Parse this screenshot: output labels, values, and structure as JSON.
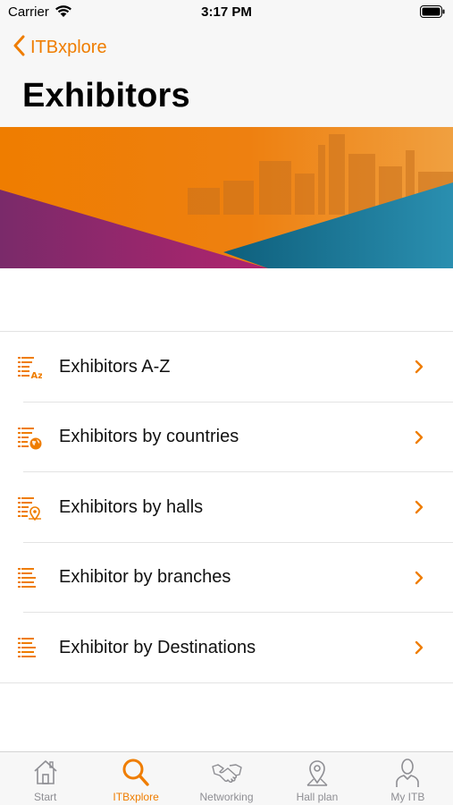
{
  "status_bar": {
    "carrier": "Carrier",
    "time": "3:17 PM"
  },
  "nav": {
    "back_label": "ITBxplore",
    "title": "Exhibitors"
  },
  "colors": {
    "accent": "#ef7d00",
    "banner_orange": "#ef7d00",
    "banner_purple": "#8e2a73",
    "banner_teal": "#1f7f9a"
  },
  "menu": {
    "items": [
      {
        "label": "Exhibitors A-Z",
        "icon": "list-az-icon"
      },
      {
        "label": "Exhibitors by countries",
        "icon": "list-globe-icon"
      },
      {
        "label": "Exhibitors by halls",
        "icon": "list-location-icon"
      },
      {
        "label": "Exhibitor by branches",
        "icon": "list-icon"
      },
      {
        "label": "Exhibitor by Destinations",
        "icon": "list-icon"
      }
    ]
  },
  "tabbar": {
    "tabs": [
      {
        "label": "Start",
        "icon": "home-icon",
        "active": false
      },
      {
        "label": "ITBxplore",
        "icon": "search-icon",
        "active": true
      },
      {
        "label": "Networking",
        "icon": "handshake-icon",
        "active": false
      },
      {
        "label": "Hall plan",
        "icon": "map-pin-icon",
        "active": false
      },
      {
        "label": "My ITB",
        "icon": "person-icon",
        "active": false
      }
    ]
  }
}
